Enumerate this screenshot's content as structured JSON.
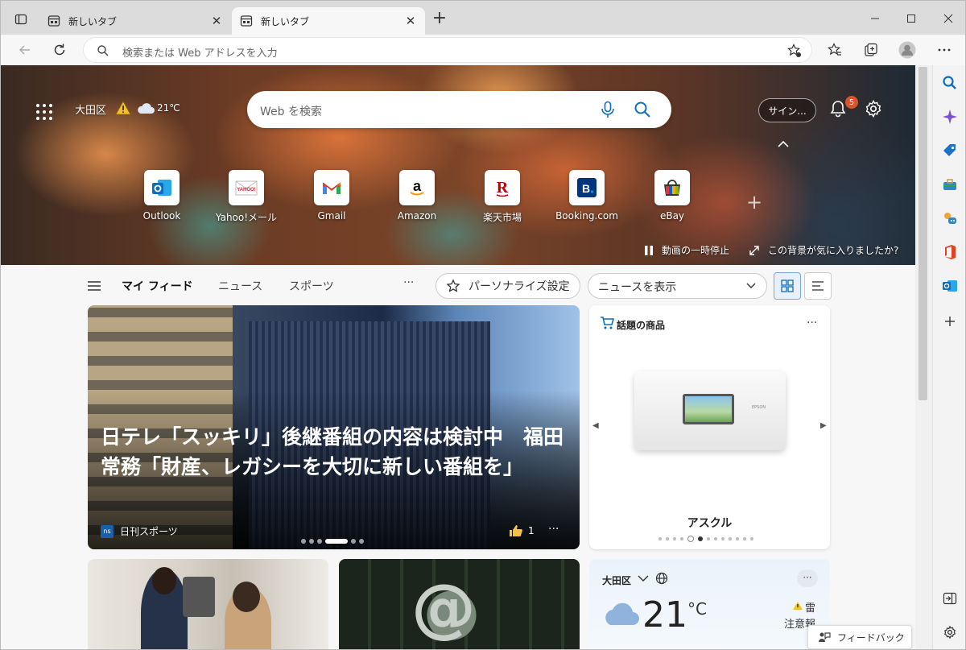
{
  "tabs": [
    {
      "title": "新しいタブ",
      "close": "✕"
    },
    {
      "title": "新しいタブ",
      "close": "✕"
    }
  ],
  "new_tab_label": "+",
  "address": {
    "placeholder": "検索または Web アドレスを入力"
  },
  "hero": {
    "location": "大田区",
    "temperature": "21℃",
    "search_placeholder": "Web を検索",
    "signin_label": "サイン...",
    "notification_count": "5",
    "tiles": [
      {
        "label": "Outlook",
        "icon": "outlook-icon",
        "color": "#0f6cbd"
      },
      {
        "label": "Yahoo!メール",
        "icon": "yahoo-mail-icon",
        "color": "#d3232c"
      },
      {
        "label": "Gmail",
        "icon": "gmail-icon",
        "color": "#ea4335"
      },
      {
        "label": "Amazon",
        "icon": "amazon-icon",
        "color": "#111111"
      },
      {
        "label": "楽天市場",
        "icon": "rakuten-icon",
        "color": "#bf0000"
      },
      {
        "label": "Booking.com",
        "icon": "booking-icon",
        "color": "#003580"
      },
      {
        "label": "eBay",
        "icon": "ebay-icon",
        "color": "#0064d2"
      }
    ],
    "pause_label": "動画の一時停止",
    "like_bg_label": "この背景が気に入りましたか?"
  },
  "feed_nav": {
    "tabs": [
      "マイ フィード",
      "ニュース",
      "スポーツ"
    ],
    "more": "···",
    "personalize": "パーソナライズ設定",
    "news_dropdown": "ニュースを表示"
  },
  "headline_card": {
    "title": "日テレ「スッキリ」後継番組の内容は検討中　福田常務「財産、レガシーを大切に新しい番組を」",
    "source": "日刊スポーツ",
    "source_logo": "ns",
    "likes": "1",
    "more": "···"
  },
  "product_card": {
    "title": "話題の商品",
    "name": "アスクル",
    "printer_brand": "EPSON",
    "more": "···"
  },
  "weather_card": {
    "location": "大田区",
    "temperature": "21",
    "unit": "°C",
    "alert": "雷",
    "alert_level": "注意報",
    "more": "···"
  },
  "feedback_label": "フィードバック",
  "colors": {
    "accent": "#0f6cbd",
    "badge": "#d9532c"
  }
}
